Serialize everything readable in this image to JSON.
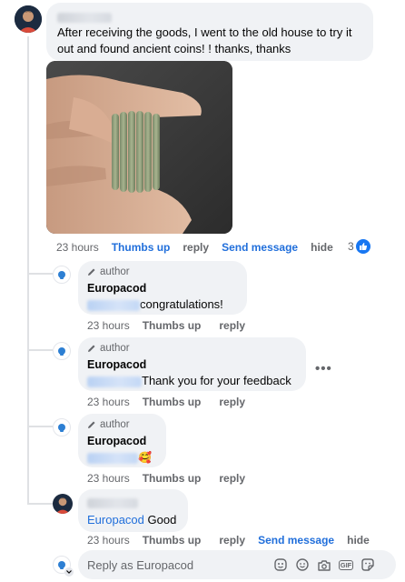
{
  "main_comment": {
    "text": "After receiving the goods, I went to the old house to try it out and found ancient coins! ! thanks, thanks",
    "time": "23 hours",
    "like_label": "Thumbs up",
    "reply_label": "reply",
    "send_message_label": "Send message",
    "hide_label": "hide",
    "reaction_count": "3"
  },
  "replies": [
    {
      "author_label": "author",
      "name": "Europacod",
      "text": "congratulations!",
      "time": "23 hours",
      "like_label": "Thumbs up",
      "reply_label": "reply"
    },
    {
      "author_label": "author",
      "name": "Europacod",
      "text": "Thank you for your feedback",
      "time": "23 hours",
      "like_label": "Thumbs up",
      "reply_label": "reply"
    },
    {
      "author_label": "author",
      "name": "Europacod",
      "text": "",
      "emoji": "🥰",
      "time": "23 hours",
      "like_label": "Thumbs up",
      "reply_label": "reply"
    }
  ],
  "user_reply": {
    "mention": "Europacod",
    "text": "Good",
    "time": "23 hours",
    "like_label": "Thumbs up",
    "reply_label": "reply",
    "send_message_label": "Send message",
    "hide_label": "hide"
  },
  "reply_box": {
    "placeholder": "Reply as Europacod"
  },
  "more_label": "•••",
  "icons": {
    "author": "pencil-icon",
    "like_badge": "thumbs-up-icon",
    "sticker": "sticker-icon",
    "emoji": "smiley-icon",
    "camera": "camera-icon",
    "gif": "gif-icon",
    "avatar_sticker": "avatar-sticker-icon",
    "chevron": "chevron-down-icon"
  },
  "colors": {
    "link_blue": "#216fdb",
    "bubble_bg": "#f0f2f5",
    "secondary_text": "#65676b",
    "like_badge": "#1877f2"
  }
}
